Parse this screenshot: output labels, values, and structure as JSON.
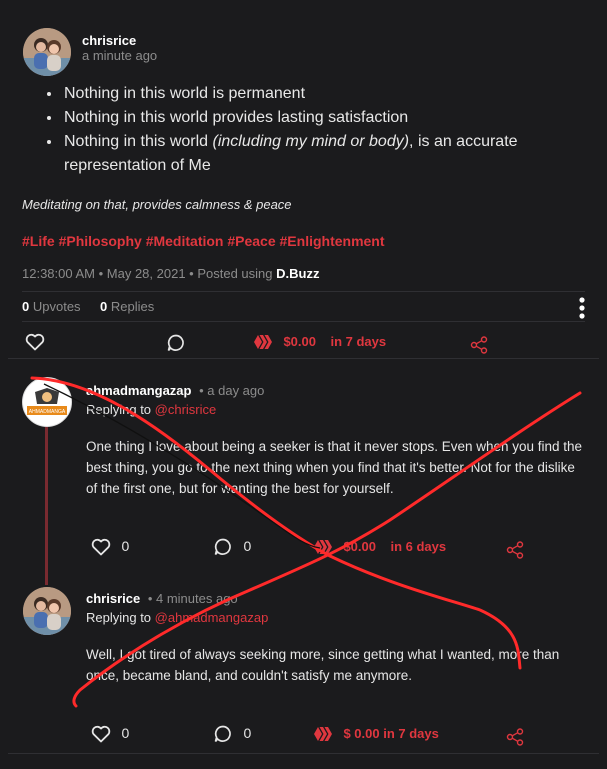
{
  "post": {
    "author": "chrisrice",
    "time_ago": "a minute ago",
    "bullets": [
      {
        "plain": "Nothing in this world is permanent"
      },
      {
        "plain": "Nothing in this world provides lasting satisfaction"
      },
      {
        "pre": "Nothing in this world ",
        "italic": "(including my mind or body)",
        "post": ", is an accurate representation of Me"
      }
    ],
    "italic_line": "Meditating on that, provides calmness & peace",
    "tags": "#Life #Philosophy #Meditation #Peace #Enlightenment",
    "timestamp": "12:38:00 AM • May 28, 2021 • Posted using ",
    "posted_using": "D.Buzz",
    "upvotes_count": "0",
    "upvotes_label": "Upvotes",
    "replies_count": "0",
    "replies_label": "Replies",
    "payout": "$0.00",
    "payout_time": "in 7 days"
  },
  "reply1": {
    "author": "ahmadmangazap",
    "time_ago": "• a day ago",
    "replying_label": "Replying to ",
    "replying_to": "@chrisrice",
    "text": "One thing I love about being a seeker is that it never stops. Even when you find the best thing, you go to the next thing when you find that it's better. Not for the dislike of the first one, but for wanting the best for yourself.",
    "like_count": "0",
    "comment_count": "0",
    "payout": "$0.00",
    "payout_time": "in 6 days",
    "avatar_text": "AHMADMANGA"
  },
  "reply2": {
    "author": "chrisrice",
    "time_ago": "• 4 minutes ago",
    "replying_label": "Replying to ",
    "replying_to": "@ahmadmangazap",
    "text": "Well, I got tired of always seeking more, since getting what I wanted, more than once, became bland, and couldn't satisfy me anymore.",
    "like_count": "0",
    "comment_count": "0",
    "payout": "$ 0.00 in 7 days"
  },
  "colors": {
    "background": "#1b1b1d",
    "accent": "#e0373f",
    "muted": "#8c8c8c",
    "overlay_scribble": "#ff2a2a"
  }
}
